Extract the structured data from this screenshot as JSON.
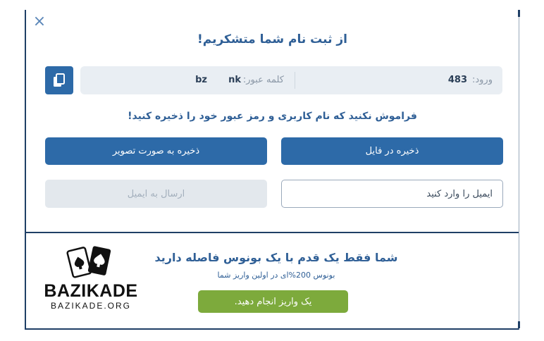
{
  "modal": {
    "close_glyph": "×",
    "title": "از ثبت نام شما متشکریم!",
    "credentials": {
      "login_label": "ورود:",
      "login_value": "483",
      "password_label": "کلمه عبور:",
      "password_value_a": "nk",
      "password_value_b": "bz"
    },
    "copy_icon": "copy-icon",
    "reminder": "فراموش نکنید که نام کاربری و رمز عبور خود را ذخیره کنید!",
    "buttons": {
      "save_file": "ذخیره در فایل",
      "save_image": "ذخیره به صورت تصویر",
      "send_email": "ارسال به ایمیل"
    },
    "email": {
      "placeholder": "ایمیل را وارد کنید",
      "value": ""
    },
    "promo": {
      "title": "شما فقط یک قدم با یک بونوس فاصله دارید",
      "subtitle": "بونوس 200%ای در اولین واریز شما",
      "deposit_button": "یک واریز انجام دهید."
    },
    "logo": {
      "word": "BAZIKADE",
      "url": "BAZIKADE.ORG"
    }
  },
  "colors": {
    "primary": "#2d6aa8",
    "title_text": "#2f5f96",
    "accent_green": "#7daa3c",
    "border_dark": "#1f3f66",
    "cred_bg": "#e9eef3"
  }
}
